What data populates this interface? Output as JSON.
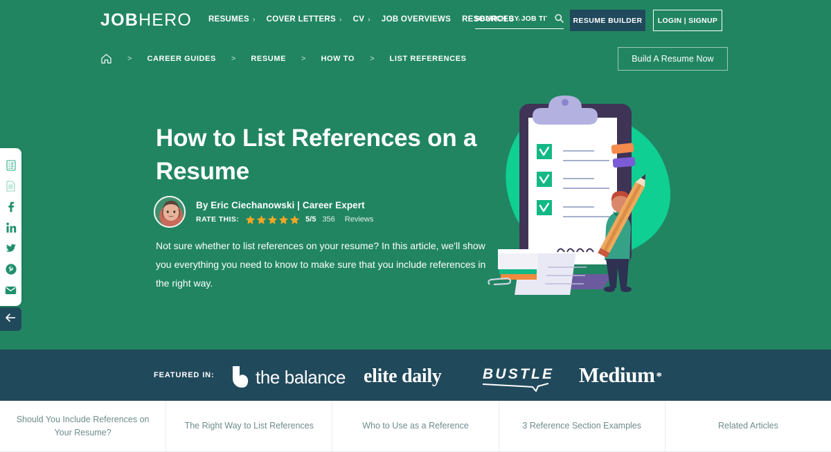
{
  "colors": {
    "brand_green": "#218562",
    "dark_navy": "#21495c",
    "accent_teal": "#12b886",
    "star_orange": "#f5a623",
    "tab_text": "#6e8b8a"
  },
  "header": {
    "logo_bold": "JOB",
    "logo_light": "HERO",
    "nav": [
      {
        "label": "RESUMES",
        "has_chevron": true
      },
      {
        "label": "COVER LETTERS",
        "has_chevron": true
      },
      {
        "label": "CV",
        "has_chevron": true
      },
      {
        "label": "JOB OVERVIEWS",
        "has_chevron": false
      },
      {
        "label": "RESOURCES",
        "has_chevron": true
      }
    ],
    "search": {
      "placeholder": "SEARCH BY JOB TITLE",
      "value": "",
      "icon": "search-icon"
    },
    "resume_builder_label": "RESUME BUILDER",
    "login_label": "LOGIN | SIGNUP"
  },
  "breadcrumb": {
    "home_icon": "home-icon",
    "separator": ">",
    "items": [
      "CAREER GUIDES",
      "RESUME",
      "HOW TO",
      "LIST REFERENCES"
    ],
    "cta_label": "Build A Resume Now"
  },
  "hero": {
    "title": "How to List References on a Resume",
    "author": "By Eric Ciechanowski | Career Expert",
    "rate_label": "RATE THIS:",
    "stars_filled": 5,
    "stars_total": 5,
    "score": "5/5",
    "review_count": "356",
    "review_word": "Reviews",
    "lede": "Not sure whether to list references on your resume? In this article, we'll show you everything you need to know to make sure that you include references in the right way.",
    "illustration": "clipboard-checklist-illustration"
  },
  "social_rail": {
    "items": [
      {
        "icon": "list-document-icon",
        "label": "Table of contents"
      },
      {
        "icon": "document-icon",
        "label": "Document"
      },
      {
        "icon": "facebook-icon",
        "label": "Facebook"
      },
      {
        "icon": "linkedin-icon",
        "label": "LinkedIn"
      },
      {
        "icon": "twitter-icon",
        "label": "Twitter"
      },
      {
        "icon": "pinterest-icon",
        "label": "Pinterest"
      },
      {
        "icon": "email-icon",
        "label": "Email"
      }
    ],
    "back_icon": "arrow-left-icon"
  },
  "featured": {
    "label": "FEATURED IN:",
    "logos": [
      {
        "name": "the-balance-logo",
        "text": "the balance"
      },
      {
        "name": "elite-daily-logo",
        "text": "elite daily"
      },
      {
        "name": "bustle-logo",
        "text": "BUSTLE"
      },
      {
        "name": "medium-logo",
        "text": "Medium",
        "mark": "*"
      }
    ]
  },
  "tabs": [
    "Should You Include References on Your Resume?",
    "The Right Way to List References",
    "Who to Use as a Reference",
    "3 Reference Section Examples",
    "Related Articles"
  ]
}
